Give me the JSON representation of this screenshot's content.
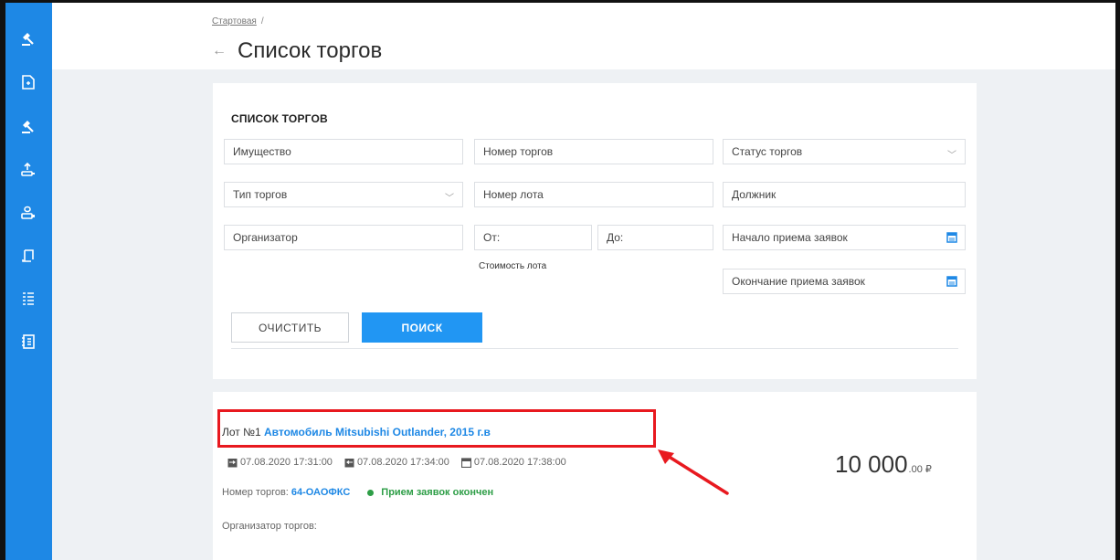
{
  "breadcrumb": {
    "home": "Стартовая",
    "separator": "/"
  },
  "header": {
    "back_icon": "arrow-left-icon",
    "title": "Список торгов"
  },
  "sidebar": {
    "items": [
      {
        "icon": "gavel-icon"
      },
      {
        "icon": "document-icon"
      },
      {
        "icon": "gavel-icon"
      },
      {
        "icon": "upload-icon"
      },
      {
        "icon": "download-icon"
      },
      {
        "icon": "scroll-icon"
      },
      {
        "icon": "list-icon"
      },
      {
        "icon": "address-book-icon"
      }
    ],
    "color": "#1e88e5"
  },
  "filters": {
    "title": "СПИСОК ТОРГОВ",
    "property_placeholder": "Имущество",
    "trade_number_placeholder": "Номер торгов",
    "trade_status_placeholder": "Статус торгов",
    "trade_type_placeholder": "Тип торгов",
    "lot_number_placeholder": "Номер лота",
    "debtor_placeholder": "Должник",
    "organizer_placeholder": "Организатор",
    "price_from_placeholder": "От:",
    "price_to_placeholder": "До:",
    "lot_price_label": "Стоимость лота",
    "application_start_placeholder": "Начало приема заявок",
    "application_end_placeholder": "Окончание приема заявок",
    "clear_label": "ОЧИСТИТЬ",
    "search_label": "ПОИСК"
  },
  "lot": {
    "prefix": "Лот №1",
    "name": "Автомобиль Mitsubishi Outlander, 2015 г.в",
    "dates": [
      "07.08.2020 17:31:00",
      "07.08.2020 17:34:00",
      "07.08.2020 17:38:00"
    ],
    "trade_number_label": "Номер торгов:",
    "trade_number": "64-ОАОФКС",
    "status": "Прием заявок окончен",
    "status_color": "#2e9e47",
    "organizer_label": "Организатор торгов:",
    "price_main": "10 000",
    "price_cents": ".00",
    "currency": "₽"
  },
  "annotation": {
    "color": "#e8191f"
  }
}
